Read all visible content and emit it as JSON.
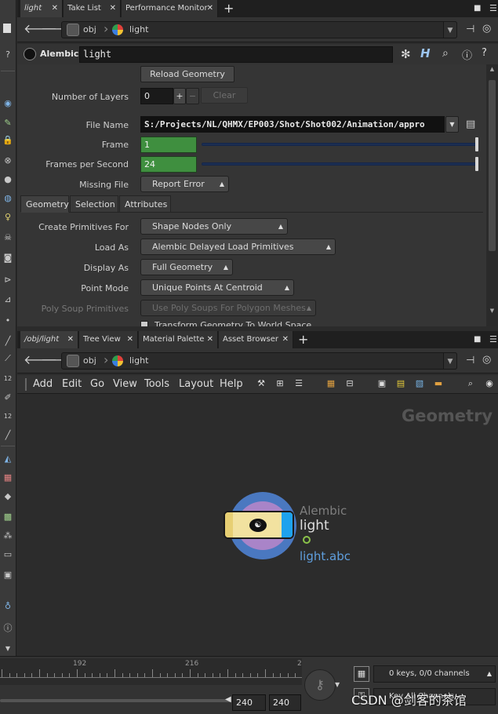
{
  "top_pane": {
    "tabs": [
      {
        "label": "light",
        "active": true
      },
      {
        "label": "Take List",
        "active": false
      },
      {
        "label": "Performance Monitor",
        "active": false
      }
    ],
    "path": {
      "root": "obj",
      "node": "light"
    }
  },
  "param_pane": {
    "node_type": "Alembic",
    "node_name": "light",
    "reload_button": "Reload Geometry",
    "number_of_layers": {
      "label": "Number of Layers",
      "value": "0",
      "plus": "+",
      "minus": "−",
      "clear": "Clear"
    },
    "file_name": {
      "label": "File Name",
      "value": "S:/Projects/NL/QHMX/EP003/Shot/Shot002/Animation/appro"
    },
    "frame": {
      "label": "Frame",
      "value": "1"
    },
    "fps": {
      "label": "Frames per Second",
      "value": "24"
    },
    "missing_file": {
      "label": "Missing File",
      "value": "Report Error"
    },
    "subtabs": [
      "Geometry",
      "Selection",
      "Attributes"
    ],
    "rows": [
      {
        "label": "Create Primitives For",
        "value": "Shape Nodes Only"
      },
      {
        "label": "Load As",
        "value": "Alembic Delayed Load Primitives"
      },
      {
        "label": "Display As",
        "value": "Full Geometry"
      },
      {
        "label": "Point Mode",
        "value": "Unique Points At Centroid"
      },
      {
        "label": "Poly Soup Primitives",
        "value": "Use Poly Soups For Polygon Meshes"
      }
    ],
    "transform_checkbox": "Transform Geometry To World Space"
  },
  "bottom_pane": {
    "tabs": [
      {
        "label": "/obj/light",
        "active": true
      },
      {
        "label": "Tree View",
        "active": false
      },
      {
        "label": "Material Palette",
        "active": false
      },
      {
        "label": "Asset Browser",
        "active": false
      }
    ],
    "path": {
      "root": "obj",
      "node": "light"
    },
    "menus": [
      "Add",
      "Edit",
      "Go",
      "View",
      "Tools",
      "Layout",
      "Help"
    ],
    "context_label": "Geometry",
    "node": {
      "type": "Alembic",
      "name": "light",
      "file": "light.abc"
    }
  },
  "timeline": {
    "ticks": [
      "192",
      "216",
      "2"
    ],
    "keys_status": "0 keys, 0/0 channels",
    "end_frame_1": "240",
    "end_frame_2": "240",
    "key_all": "Key All Channels",
    "watermark": "CSDN @剑客的茶馆"
  },
  "colors": {
    "accent_blue": "#3a7ee0",
    "field_green": "#3f8f3f",
    "node_yellow": "#f2e2a0",
    "node_blue_ring": "#4a78c0",
    "node_purple": "#a984c8"
  }
}
